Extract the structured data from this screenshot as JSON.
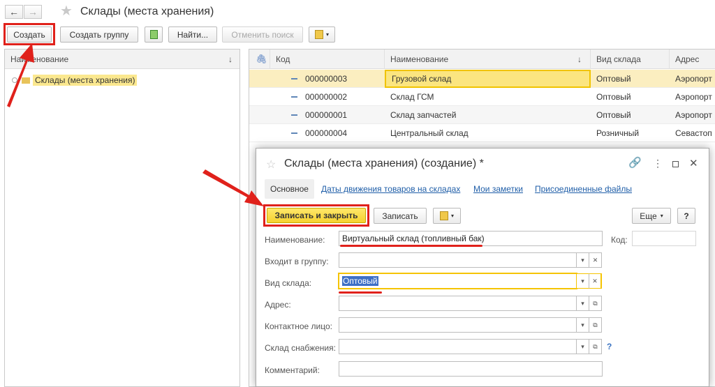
{
  "window": {
    "title": "Склады (места хранения)"
  },
  "toolbar": {
    "create_label": "Создать",
    "create_group_label": "Создать группу",
    "find_label": "Найти...",
    "cancel_search_label": "Отменить поиск"
  },
  "tree": {
    "header": "Наименование",
    "sort_indicator": "↓",
    "root_item": "Склады (места хранения)"
  },
  "table": {
    "headers": {
      "code": "Код",
      "name": "Наименование",
      "sort_indicator": "↓",
      "kind": "Вид склада",
      "address": "Адрес"
    },
    "rows": [
      {
        "code": "000000003",
        "name": "Грузовой склад",
        "kind": "Оптовый",
        "address": "Аэропорт"
      },
      {
        "code": "000000002",
        "name": "Склад ГСМ",
        "kind": "Оптовый",
        "address": "Аэропорт"
      },
      {
        "code": "000000001",
        "name": "Склад запчастей",
        "kind": "Оптовый",
        "address": "Аэропорт"
      },
      {
        "code": "000000004",
        "name": "Центральный склад",
        "kind": "Розничный",
        "address": "Севастоп"
      }
    ]
  },
  "form": {
    "title": "Склады (места хранения) (создание) *",
    "tabs": {
      "main": "Основное",
      "movement_dates": "Даты движения товаров на складах",
      "notes": "Мои заметки",
      "attachments": "Присоединенные файлы"
    },
    "buttons": {
      "save_close": "Записать и закрыть",
      "save": "Записать",
      "more": "Еще",
      "help": "?"
    },
    "labels": {
      "name": "Наименование:",
      "code": "Код:",
      "group": "Входит в группу:",
      "kind": "Вид склада:",
      "address": "Адрес:",
      "contact": "Контактное лицо:",
      "supply": "Склад снабжения:",
      "comment": "Комментарий:"
    },
    "values": {
      "name": "Виртуальный склад (топливный бак)",
      "code": "",
      "group": "",
      "kind": "Оптовый",
      "address": "",
      "contact": "",
      "supply": "",
      "comment": ""
    },
    "supply_help": "?"
  },
  "colors": {
    "highlight_red": "#e0211b",
    "primary_yellow": "#f5d12e",
    "link_blue": "#1f5ea8",
    "selection": "#fbeec0"
  }
}
